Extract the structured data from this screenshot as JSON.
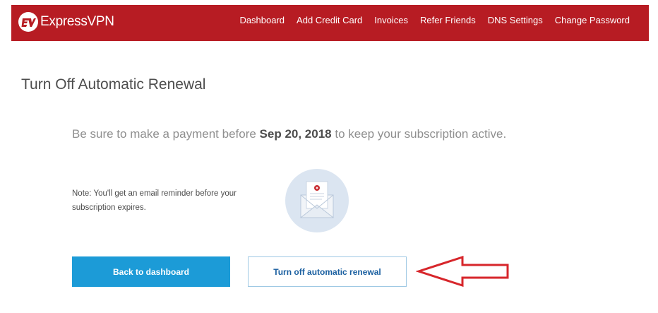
{
  "brand": {
    "name": "ExpressVPN",
    "primary_color": "#b71c23",
    "logo_icon": "expressvpn-logo-icon"
  },
  "nav": {
    "items": [
      {
        "label": "Dashboard"
      },
      {
        "label": "Add Credit Card"
      },
      {
        "label": "Invoices"
      },
      {
        "label": "Refer Friends"
      },
      {
        "label": "DNS Settings"
      },
      {
        "label": "Change Password"
      }
    ]
  },
  "main": {
    "title": "Turn Off Automatic Renewal",
    "reminder_prefix": "Be sure to make a payment before",
    "reminder_date": "Sep 20, 2018",
    "reminder_suffix": "to keep your subscription active.",
    "note": "Note: You'll get an email reminder before your subscription expires.",
    "illustration_icon": "email-envelope-icon"
  },
  "actions": {
    "back_label": "Back to dashboard",
    "turn_off_label": "Turn off automatic renewal",
    "primary_button_color": "#1c9bd7"
  },
  "annotation": {
    "arrow_icon": "red-outline-arrow-icon",
    "arrow_color": "#d7262b"
  }
}
